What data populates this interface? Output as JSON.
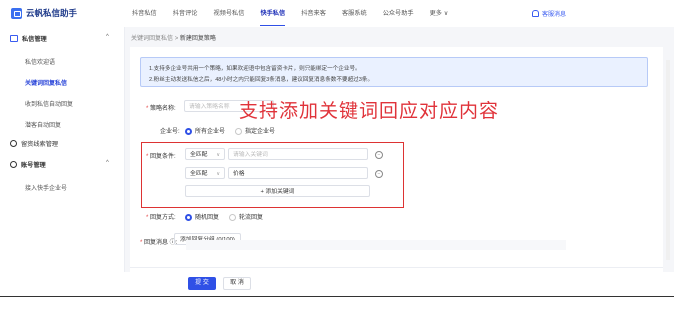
{
  "app": {
    "title": "云帆私信助手"
  },
  "nav": {
    "items": [
      "抖音私信",
      "抖音评论",
      "视频号私信",
      "快手私信",
      "抖音来客",
      "客服系统",
      "公众号助手",
      "更多"
    ],
    "active_index": 3
  },
  "top_right": {
    "label": "客服消息"
  },
  "sidebar": {
    "group1": "私信管理",
    "items": [
      "私信欢迎语",
      "关键词回复私信",
      "收到私信自动回复",
      "潜客自动回复"
    ],
    "active_index": 1,
    "group2": "留资线索管理",
    "group3": "账号管理",
    "group3_items": [
      "接入快手企业号"
    ]
  },
  "breadcrumb": {
    "parent": "关键词回复私信",
    "sep": ">",
    "current": "新建回复策略"
  },
  "notice": {
    "line1": "1.支持多企业号共用一个策略，如果欢迎语中包含留资卡片，则只能绑定一个企业号。",
    "line2": "2.粉丝主动发送私信之后，48小时之内只能回复3条消息，建议回复消息条数不要超过3条。"
  },
  "form": {
    "strategy_name_label": "策略名称:",
    "strategy_name_placeholder": "请输入策略名称",
    "company_label": "企业号:",
    "company_opt1": "所有企业号",
    "company_opt2": "指定企业号",
    "condition_label": "回复条件:",
    "cond1_match": "全匹配",
    "cond1_placeholder": "请输入关键词",
    "cond2_match": "全匹配",
    "cond2_value": "价格",
    "add_keyword": "+ 添加关键词",
    "method_label": "回复方式:",
    "method_opt1": "随机回复",
    "method_opt2": "轮流回复",
    "message_label": "回复消息 ⓘ:",
    "add_group": "添加回复分组 (0/100)"
  },
  "overlay_text": "支持添加关键词回应对应内容",
  "footer": {
    "submit": "提 交",
    "cancel": "取 消"
  },
  "colors": {
    "accent": "#2f50e6",
    "annotation": "#e0333a"
  }
}
